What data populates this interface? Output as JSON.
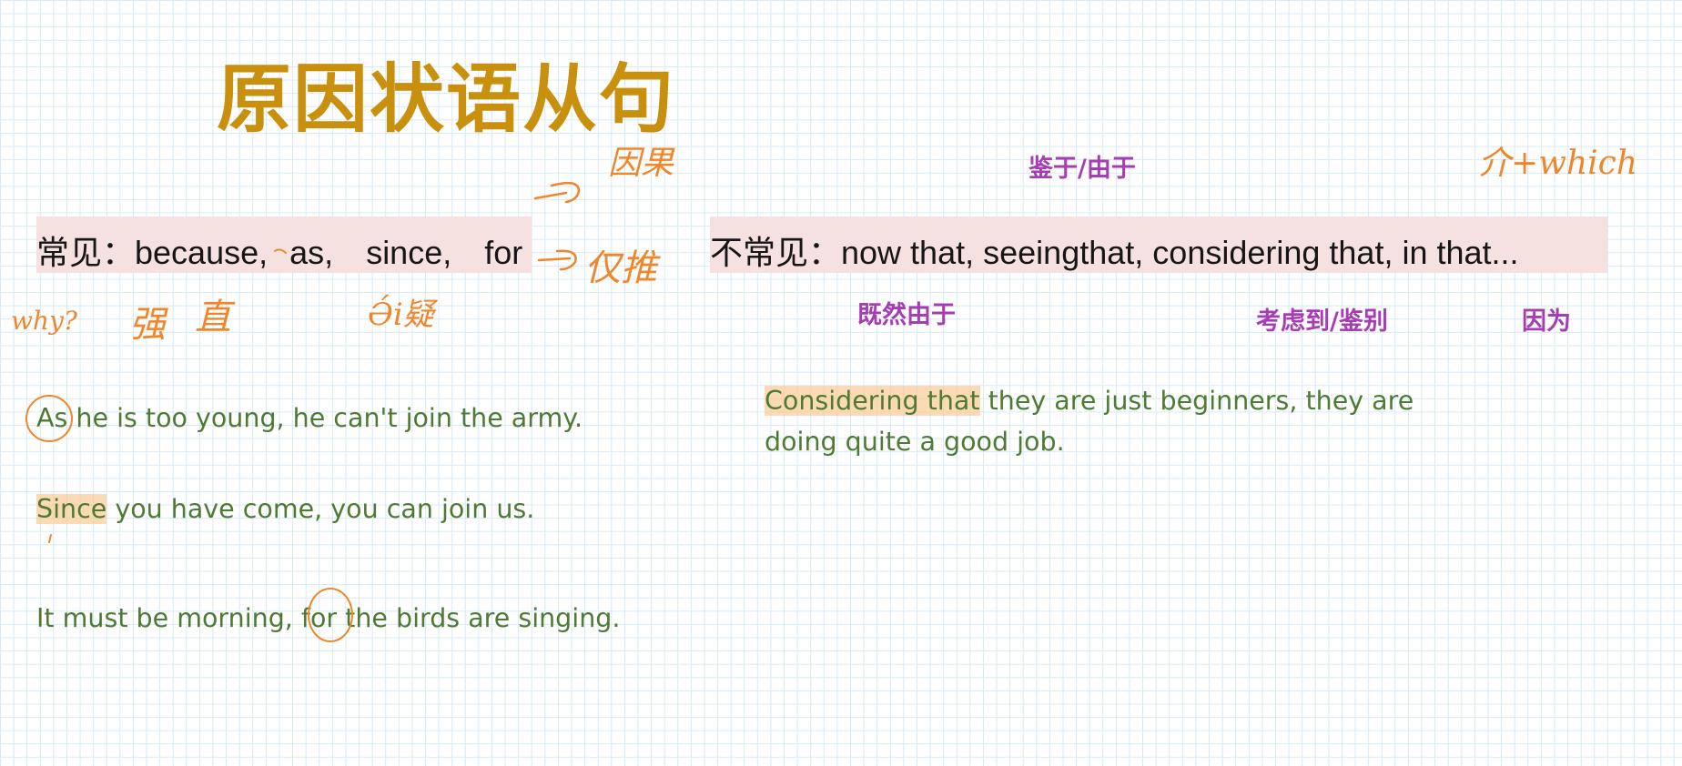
{
  "title": "原因状语从句",
  "common": {
    "label": "常见：",
    "words": [
      "because,",
      "as,",
      "since,",
      "for"
    ]
  },
  "uncommon": {
    "label": "不常见：",
    "words": [
      "now that,",
      "seeing",
      "that,",
      "considering that,",
      "in that..."
    ]
  },
  "meanings": {
    "jianyu_youyu": "鉴于/由于",
    "jiran_youyu": "既然由于",
    "kaolvdao_jianbie": "考虑到/鉴别",
    "yinwei": "因为"
  },
  "handwriting": {
    "yinguo": "因果",
    "tuili": "仅推",
    "jie_which": "介+which",
    "why": "why?",
    "qiang": "强",
    "zhi": "直",
    "rule": "Ə́i疑"
  },
  "examples": {
    "as_keyword": "As",
    "as_rest": " he is too young, he can't join the army.",
    "since_keyword": "Since",
    "since_rest": " you have come, you can join us.",
    "for_prefix": "It must be morning, ",
    "for_keyword": "for",
    "for_rest": " the birds are singing.",
    "considering_keyword": "Considering that",
    "considering_line1_rest": " they are just beginners, they are",
    "considering_line2": "doing quite a good job."
  },
  "colors": {
    "title": "#c8900c",
    "purple_meaning": "#a63db3",
    "handwriting": "#f0862a",
    "example_text": "#4f7a34",
    "band": "#f6e1e1",
    "grid": "#d6e9f6"
  }
}
